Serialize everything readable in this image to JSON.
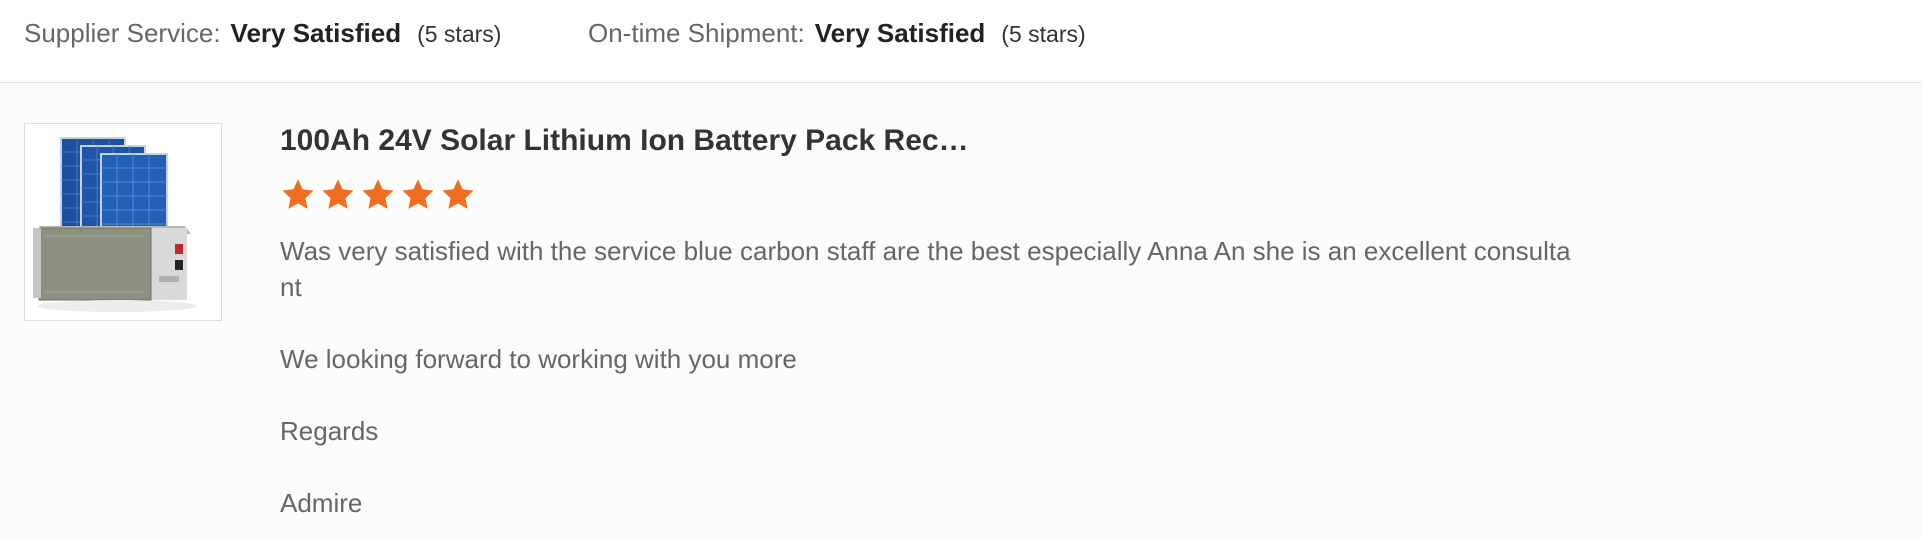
{
  "summary": {
    "supplier_service": {
      "label": "Supplier Service:",
      "value": "Very Satisfied",
      "stars": "(5 stars)"
    },
    "ontime_shipment": {
      "label": "On-time Shipment:",
      "value": "Very Satisfied",
      "stars": "(5 stars)"
    }
  },
  "review": {
    "product_image_icon": "solar-battery-product-image",
    "product_title": "100Ah 24V Solar Lithium Ion Battery Pack Rec…",
    "rating": {
      "stars": 5,
      "max": 5,
      "color": "#f26c22",
      "icon": "star-icon"
    },
    "text_lines": [
      "Was very satisfied with the service blue carbon staff are the best especially Anna An she is an excellent consultant",
      "We looking forward to working with you more",
      "Regards",
      "Admire"
    ]
  }
}
